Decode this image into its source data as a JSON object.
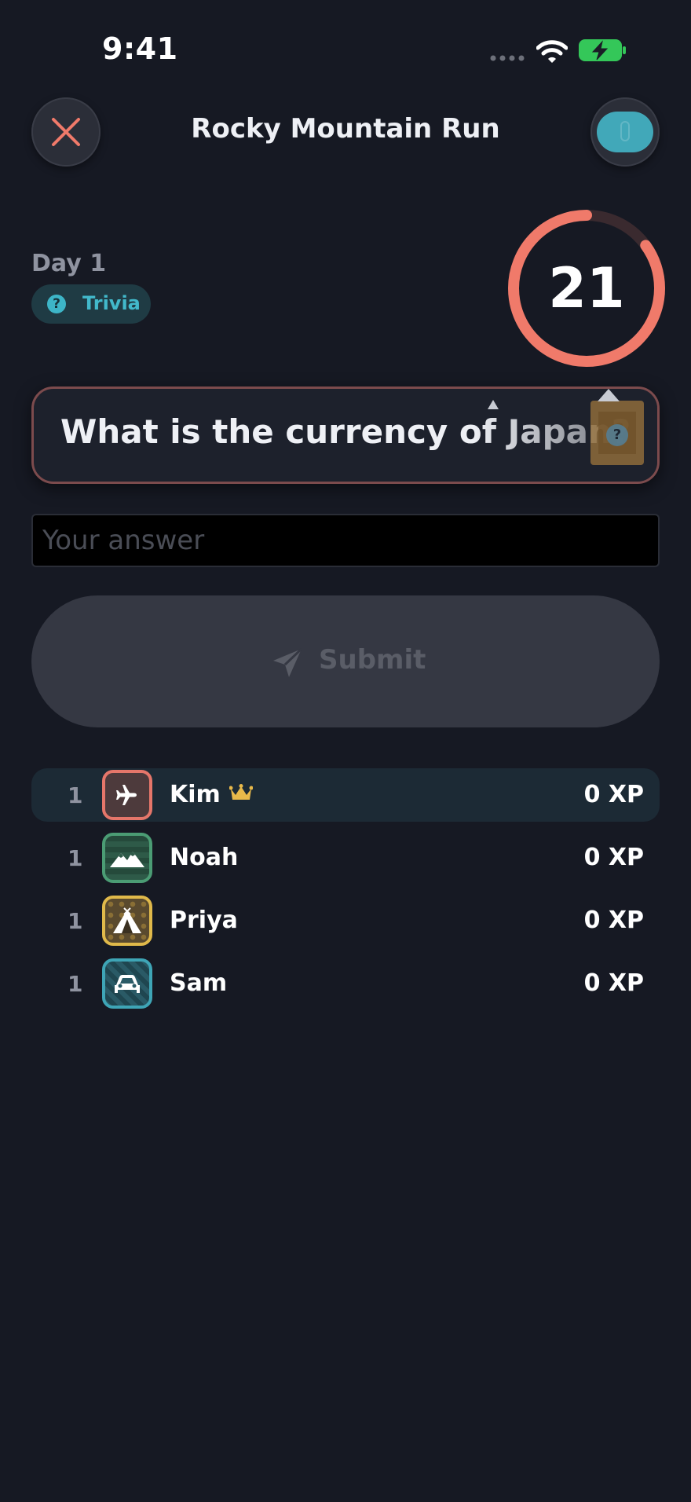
{
  "status_bar": {
    "time": "9:41"
  },
  "header": {
    "title": "Rocky Mountain Run"
  },
  "challenge": {
    "day_label": "Day 1",
    "category": "Trivia",
    "timer_seconds": "21",
    "timer_fraction_remaining": 0.85
  },
  "question": {
    "text": "What is the currency of Japan?"
  },
  "answer": {
    "placeholder": "Your answer",
    "value": ""
  },
  "submit": {
    "label": "Submit"
  },
  "leaderboard": [
    {
      "rank": "1",
      "name": "Kim",
      "xp": "0 XP",
      "leader": true,
      "avatar_icon": "airplane-icon",
      "color": "#e5766a"
    },
    {
      "rank": "1",
      "name": "Noah",
      "xp": "0 XP",
      "leader": false,
      "avatar_icon": "mountains-icon",
      "color": "#4b9c74"
    },
    {
      "rank": "1",
      "name": "Priya",
      "xp": "0 XP",
      "leader": false,
      "avatar_icon": "tent-icon",
      "color": "#e0b94a"
    },
    {
      "rank": "1",
      "name": "Sam",
      "xp": "0 XP",
      "leader": false,
      "avatar_icon": "car-icon",
      "color": "#3ea5b6"
    }
  ],
  "colors": {
    "background": "#161923",
    "accent_coral": "#f07a6a",
    "accent_teal": "#42b9cb",
    "crown": "#e8b94a"
  }
}
